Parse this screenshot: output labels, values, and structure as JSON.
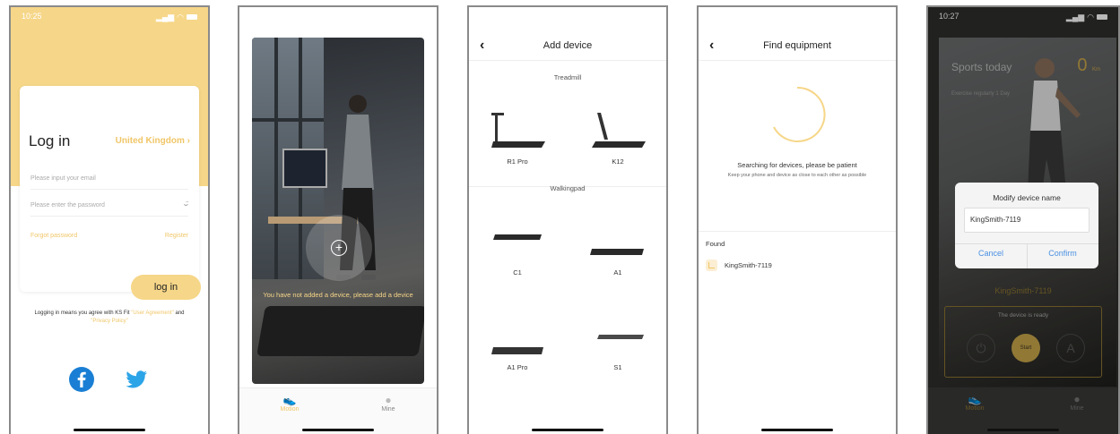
{
  "colors": {
    "accent": "#f6d688",
    "accent_text": "#f0c668",
    "link_blue": "#4a90e2"
  },
  "screen1": {
    "time": "10:25",
    "title": "Log in",
    "country": "United Kingdom",
    "email_placeholder": "Please input your email",
    "password_placeholder": "Please enter the password",
    "forgot": "Forgot password",
    "register": "Register",
    "login_button": "log in",
    "agree_prefix": "Logging in means you agree with KS Fit",
    "user_agreement": "\"User Agreement\"",
    "and": "and",
    "privacy_policy": "\"Privacy Policy\"",
    "social": [
      "facebook-icon",
      "twitter-icon"
    ]
  },
  "screen2": {
    "no_device_msg": "You have not added a device, please add a device",
    "tabs": [
      {
        "label": "Motion",
        "icon": "shoe-icon"
      },
      {
        "label": "Mine",
        "icon": "person-icon"
      }
    ]
  },
  "screen3": {
    "title": "Add device",
    "section_treadmill": "Treadmill",
    "section_walkingpad": "Walkingpad",
    "treadmill_devices": [
      "R1 Pro",
      "K12"
    ],
    "walkingpad_devices": [
      "C1",
      "A1",
      "A1 Pro",
      "S1"
    ]
  },
  "screen4": {
    "title": "Find equipment",
    "searching": "Searching for devices, please be patient",
    "hint": "Keep your phone and device as close to each other as possible",
    "found_label": "Found",
    "found_device": "KingSmith-7119"
  },
  "screen5": {
    "time": "10:27",
    "sports_today": "Sports today",
    "distance": "0",
    "distance_unit": "Km",
    "exercise": "Exercise regularly 1 Day",
    "device_name_bg": "KingSmith-7119",
    "device_ready": "The device is ready",
    "start": "Start",
    "dialog_title": "Modify device name",
    "dialog_value": "KingSmith-7119",
    "cancel": "Cancel",
    "confirm": "Confirm",
    "tabs": [
      {
        "label": "Motion"
      },
      {
        "label": "Mine"
      }
    ]
  }
}
